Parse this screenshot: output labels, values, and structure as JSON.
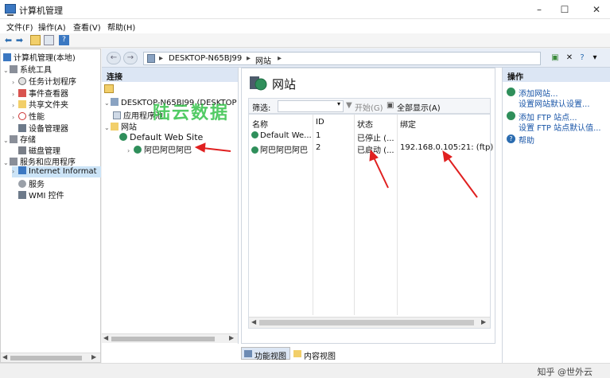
{
  "window": {
    "title": "计算机管理",
    "minimize": "–",
    "maximize": "☐",
    "close": "✕"
  },
  "menu": [
    {
      "label": "文件(F)"
    },
    {
      "label": "操作(A)"
    },
    {
      "label": "查看(V)"
    },
    {
      "label": "帮助(H)"
    }
  ],
  "tree": {
    "root": "计算机管理(本地)",
    "items": [
      {
        "label": "系统工具"
      },
      {
        "label": "任务计划程序"
      },
      {
        "label": "事件查看器"
      },
      {
        "label": "共享文件夹"
      },
      {
        "label": "性能"
      },
      {
        "label": "设备管理器"
      },
      {
        "label": "存储"
      },
      {
        "label": "磁盘管理"
      },
      {
        "label": "服务和应用程序"
      },
      {
        "label": "Internet Informat"
      },
      {
        "label": "服务"
      },
      {
        "label": "WMI 控件"
      }
    ]
  },
  "address": {
    "server": "DESKTOP-N65BJ99",
    "section": "网站",
    "sep": "▸"
  },
  "connections": {
    "header": "连接",
    "server": "DESKTOP-N65BJ99 (DESKTOP",
    "app_pools": "应用程序池",
    "sites": "网站",
    "site1": "Default Web Site",
    "site2": "阿巴阿巴阿巴"
  },
  "center": {
    "title": "网站",
    "filter_label": "筛选:",
    "start": "开始(G)",
    "show_all": "全部显示(A)",
    "columns": [
      "名称",
      "ID",
      "状态",
      "绑定"
    ],
    "rows": [
      {
        "name": "Default We...",
        "id": "1",
        "status": "已停止 (...",
        "binding": ""
      },
      {
        "name": "阿巴阿巴阿巴",
        "id": "2",
        "status": "已启动 (...",
        "binding": "192.168.0.105:21: (ftp)"
      }
    ],
    "tab_features": "功能视图",
    "tab_content": "内容视图"
  },
  "actions": {
    "header": "操作",
    "links": [
      "添加网站...",
      "设置网站默认设置...",
      "添加 FTP 站点...",
      "设置 FTP 站点默认值...",
      "帮助"
    ]
  },
  "overlay": {
    "green_watermark": "陆云数据",
    "corner_watermark": "知乎 @世外云"
  },
  "colors": {
    "accent": "#1a56a8",
    "arrow": "#e02020",
    "header_bg": "#dce6f4"
  }
}
